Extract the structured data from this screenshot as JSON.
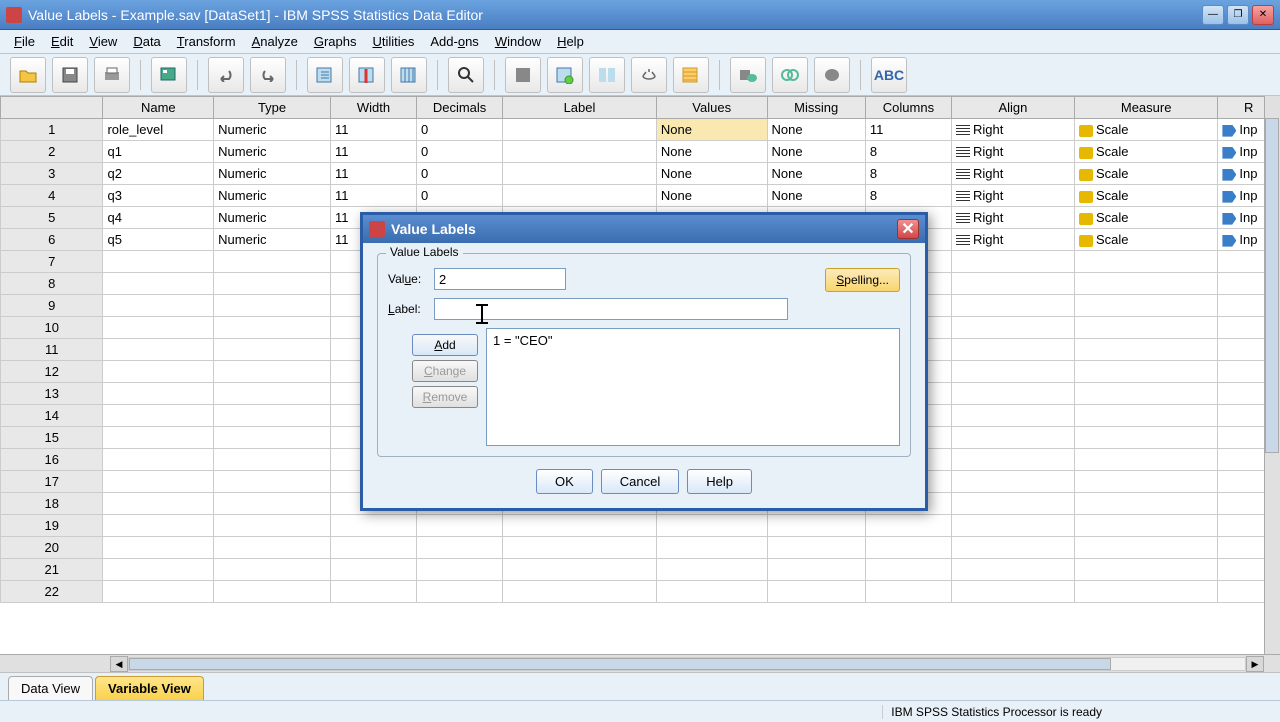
{
  "titlebar": {
    "text": "Value Labels - Example.sav [DataSet1] - IBM SPSS Statistics Data Editor"
  },
  "menu": [
    "File",
    "Edit",
    "View",
    "Data",
    "Transform",
    "Analyze",
    "Graphs",
    "Utilities",
    "Add-ons",
    "Window",
    "Help"
  ],
  "columns": [
    "",
    "Name",
    "Type",
    "Width",
    "Decimals",
    "Label",
    "Values",
    "Missing",
    "Columns",
    "Align",
    "Measure",
    "R"
  ],
  "rows": [
    {
      "n": "1",
      "name": "role_level",
      "type": "Numeric",
      "width": "11",
      "dec": "0",
      "label": "",
      "values": "None",
      "miss": "None",
      "cols": "11",
      "align": "Right",
      "measure": "Scale",
      "role": "Inp",
      "hl": true
    },
    {
      "n": "2",
      "name": "q1",
      "type": "Numeric",
      "width": "11",
      "dec": "0",
      "label": "",
      "values": "None",
      "miss": "None",
      "cols": "8",
      "align": "Right",
      "measure": "Scale",
      "role": "Inp"
    },
    {
      "n": "3",
      "name": "q2",
      "type": "Numeric",
      "width": "11",
      "dec": "0",
      "label": "",
      "values": "None",
      "miss": "None",
      "cols": "8",
      "align": "Right",
      "measure": "Scale",
      "role": "Inp"
    },
    {
      "n": "4",
      "name": "q3",
      "type": "Numeric",
      "width": "11",
      "dec": "0",
      "label": "",
      "values": "None",
      "miss": "None",
      "cols": "8",
      "align": "Right",
      "measure": "Scale",
      "role": "Inp"
    },
    {
      "n": "5",
      "name": "q4",
      "type": "Numeric",
      "width": "11",
      "dec": "",
      "label": "",
      "values": "",
      "miss": "",
      "cols": "",
      "align": "Right",
      "measure": "Scale",
      "role": "Inp"
    },
    {
      "n": "6",
      "name": "q5",
      "type": "Numeric",
      "width": "11",
      "dec": "",
      "label": "",
      "values": "",
      "miss": "",
      "cols": "",
      "align": "Right",
      "measure": "Scale",
      "role": "Inp"
    }
  ],
  "empty_rows": [
    "7",
    "8",
    "9",
    "10",
    "11",
    "12",
    "13",
    "14",
    "15",
    "16",
    "17",
    "18",
    "19",
    "20",
    "21",
    "22"
  ],
  "tabs": {
    "data": "Data View",
    "variable": "Variable View"
  },
  "status": {
    "ready": "IBM SPSS Statistics Processor is ready"
  },
  "dialog": {
    "title": "Value Labels",
    "legend": "Value Labels",
    "value_label": "Value:",
    "value_input": "2",
    "label_label": "Label:",
    "label_input": "",
    "spelling": "Spelling...",
    "add": "Add",
    "change": "Change",
    "remove": "Remove",
    "list_item": "1 = \"CEO\"",
    "ok": "OK",
    "cancel": "Cancel",
    "help": "Help"
  }
}
